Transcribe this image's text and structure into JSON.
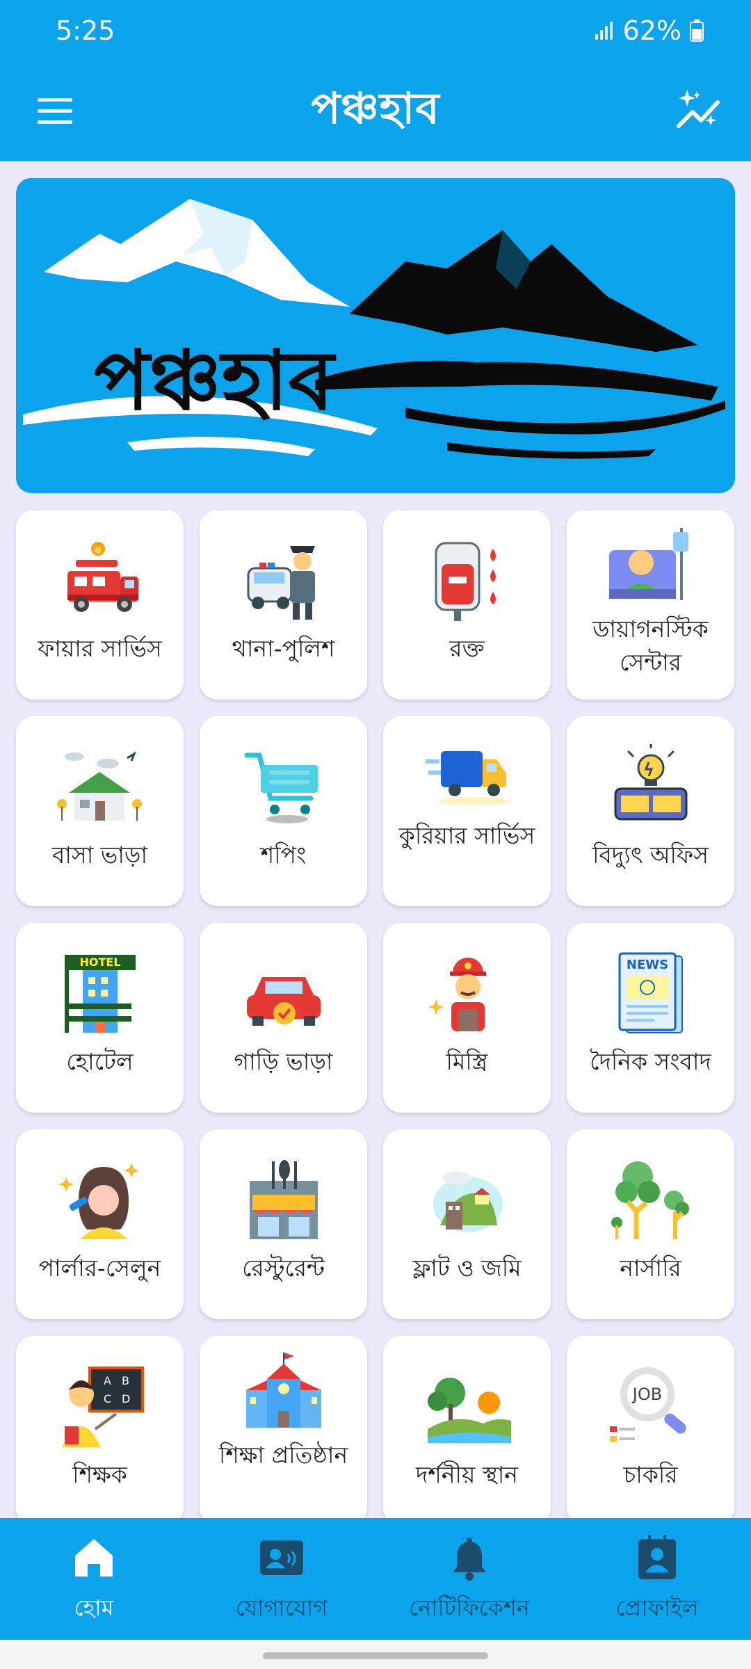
{
  "status": {
    "time": "5:25",
    "battery": "62%"
  },
  "app": {
    "title": "পঞ্চহাব"
  },
  "banner": {
    "title": "পঞ্চহাব"
  },
  "services": [
    {
      "label": "ফায়ার সার্ভিস",
      "icon": "fire-truck-icon"
    },
    {
      "label": "থানা-পুলিশ",
      "icon": "police-icon"
    },
    {
      "label": "রক্ত",
      "icon": "blood-bag-icon"
    },
    {
      "label": "ডায়াগনস্টিক সেন্টার",
      "icon": "patient-icon"
    },
    {
      "label": "বাসা ভাড়া",
      "icon": "house-icon"
    },
    {
      "label": "শপিং",
      "icon": "shopping-cart-icon"
    },
    {
      "label": "কুরিয়ার সার্ভিস",
      "icon": "delivery-truck-icon"
    },
    {
      "label": "বিদ্যুৎ অফিস",
      "icon": "electricity-icon"
    },
    {
      "label": "হোটেল",
      "icon": "hotel-icon"
    },
    {
      "label": "গাড়ি ভাড়া",
      "icon": "car-icon"
    },
    {
      "label": "মিস্ত্রি",
      "icon": "worker-icon"
    },
    {
      "label": "দৈনিক সংবাদ",
      "icon": "newspaper-icon"
    },
    {
      "label": "পার্লার-সেলুন",
      "icon": "beauty-icon"
    },
    {
      "label": "রেস্টুরেন্ট",
      "icon": "restaurant-icon"
    },
    {
      "label": "ফ্লাট ও জমি",
      "icon": "land-icon"
    },
    {
      "label": "নার্সারি",
      "icon": "tree-icon"
    },
    {
      "label": "শিক্ষক",
      "icon": "teacher-icon"
    },
    {
      "label": "শিক্ষা প্রতিষ্ঠান",
      "icon": "school-icon"
    },
    {
      "label": "দর্শনীয় স্থান",
      "icon": "landscape-icon"
    },
    {
      "label": "চাকরি",
      "icon": "job-search-icon"
    }
  ],
  "nav": [
    {
      "label": "হোম",
      "icon": "home-icon",
      "active": true
    },
    {
      "label": "যোগাযোগ",
      "icon": "contacts-icon"
    },
    {
      "label": "নোটিফিকেশন",
      "icon": "bell-icon"
    },
    {
      "label": "প্রোফাইল",
      "icon": "profile-icon"
    }
  ],
  "colors": {
    "primary": "#0BA3EB",
    "background": "#ECE9FB",
    "nav_inactive": "#1A4D6B"
  }
}
